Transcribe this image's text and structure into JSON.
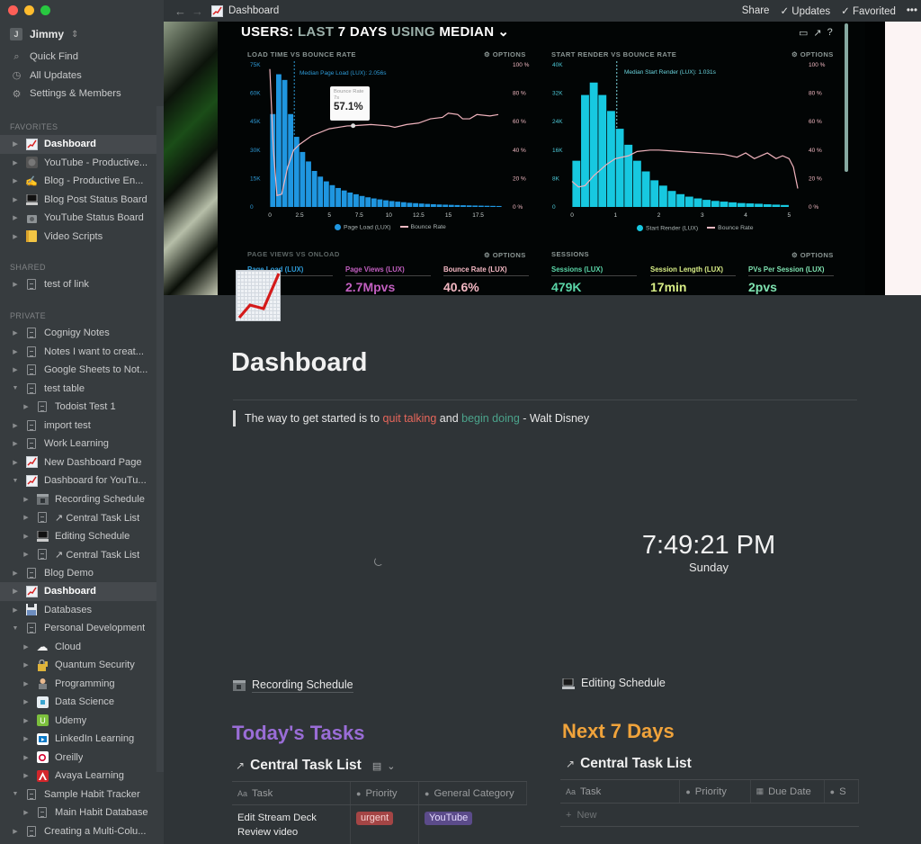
{
  "window": {
    "traffic_lights": {
      "close": "#fe5f57",
      "minimize": "#febc2e",
      "zoom": "#28c840"
    }
  },
  "sidebar": {
    "workspace": {
      "avatar_letter": "J",
      "name": "Jimmy",
      "switch_icon": "⇕"
    },
    "nav": [
      {
        "icon": "search-icon",
        "glyph": "⌕",
        "label": "Quick Find"
      },
      {
        "icon": "clock-icon",
        "glyph": "◷",
        "label": "All Updates"
      },
      {
        "icon": "gear-icon",
        "glyph": "⚙",
        "label": "Settings & Members"
      }
    ],
    "sections": {
      "favorites": "FAVORITES",
      "shared": "SHARED",
      "private": "PRIVATE"
    },
    "favorites": [
      {
        "label": "Dashboard",
        "icon": "chart-increasing-icon",
        "active": true
      },
      {
        "label": "YouTube - Productive...",
        "icon": "youtube-page-icon"
      },
      {
        "label": "Blog - Productive En...",
        "icon": "writing-hand-icon"
      },
      {
        "label": "Blog Post Status Board",
        "icon": "laptop-icon"
      },
      {
        "label": "YouTube Status Board",
        "icon": "camera-icon"
      },
      {
        "label": "Video Scripts",
        "icon": "notebook-icon"
      }
    ],
    "shared": [
      {
        "label": "test of link",
        "icon": "page-icon"
      }
    ],
    "private": [
      {
        "label": "Cognigy Notes",
        "icon": "page-icon",
        "depth": 0,
        "expanded": false
      },
      {
        "label": "Notes I want to creat...",
        "icon": "page-icon",
        "depth": 0,
        "expanded": false
      },
      {
        "label": "Google Sheets to Not...",
        "icon": "page-icon",
        "depth": 0,
        "expanded": false
      },
      {
        "label": "test table",
        "icon": "page-icon",
        "depth": 0,
        "expanded": true
      },
      {
        "label": "Todoist Test 1",
        "icon": "page-icon",
        "depth": 1,
        "expanded": false
      },
      {
        "label": "import test",
        "icon": "page-icon",
        "depth": 0,
        "expanded": false
      },
      {
        "label": "Work Learning",
        "icon": "page-icon",
        "depth": 0,
        "expanded": false
      },
      {
        "label": "New Dashboard Page",
        "icon": "chart-increasing-icon",
        "depth": 0,
        "expanded": false
      },
      {
        "label": "Dashboard for YouTu...",
        "icon": "chart-increasing-icon",
        "depth": 0,
        "expanded": true
      },
      {
        "label": "Recording Schedule",
        "icon": "cinema-icon",
        "depth": 1,
        "expanded": false
      },
      {
        "label": "↗ Central Task List",
        "icon": "page-icon",
        "depth": 1,
        "expanded": false
      },
      {
        "label": "Editing Schedule",
        "icon": "laptop-icon",
        "depth": 1,
        "expanded": false
      },
      {
        "label": "↗ Central Task List",
        "icon": "page-icon",
        "depth": 1,
        "expanded": false
      },
      {
        "label": "Blog Demo",
        "icon": "page-icon",
        "depth": 0,
        "expanded": false
      },
      {
        "label": "Dashboard",
        "icon": "chart-increasing-icon",
        "depth": 0,
        "expanded": false,
        "active": true
      },
      {
        "label": "Databases",
        "icon": "floppy-disk-icon",
        "depth": 0,
        "expanded": false
      },
      {
        "label": "Personal Development",
        "icon": "page-icon",
        "depth": 0,
        "expanded": true
      },
      {
        "label": "Cloud",
        "icon": "cloud-icon",
        "depth": 1,
        "expanded": false
      },
      {
        "label": "Quantum Security",
        "icon": "lock-key-icon",
        "depth": 1,
        "expanded": false
      },
      {
        "label": "Programming",
        "icon": "technologist-icon",
        "depth": 1,
        "expanded": false
      },
      {
        "label": "Data Science",
        "icon": "data-science-icon",
        "depth": 1,
        "expanded": false
      },
      {
        "label": "Udemy",
        "icon": "udemy-icon",
        "depth": 1,
        "expanded": false
      },
      {
        "label": "LinkedIn Learning",
        "icon": "linkedin-learning-icon",
        "depth": 1,
        "expanded": false
      },
      {
        "label": "Oreilly",
        "icon": "oreilly-icon",
        "depth": 1,
        "expanded": false
      },
      {
        "label": "Avaya Learning",
        "icon": "avaya-icon",
        "depth": 1,
        "expanded": false
      },
      {
        "label": "Sample Habit Tracker",
        "icon": "page-icon",
        "depth": 0,
        "expanded": true
      },
      {
        "label": "Main Habit Database",
        "icon": "page-icon",
        "depth": 1,
        "expanded": false
      },
      {
        "label": "Creating a Multi-Colu...",
        "icon": "page-icon",
        "depth": 0,
        "expanded": false
      }
    ]
  },
  "topbar": {
    "back": "←",
    "forward": "→",
    "page_title": "Dashboard",
    "share": "Share",
    "updates": "✓ Updates",
    "favorited": "✓ Favorited",
    "more": "•••"
  },
  "cover": {
    "header_parts": [
      {
        "text": "USERS: ",
        "dim": false
      },
      {
        "text": "LAST ",
        "dim": true
      },
      {
        "text": "7 DAYS ",
        "dim": false
      },
      {
        "text": "USING ",
        "dim": true
      },
      {
        "text": "MEDIAN",
        "dim": false
      }
    ],
    "header_chevron": "⌄",
    "top_icons": [
      "▭",
      "↗",
      "?"
    ],
    "options_label": "⚙ OPTIONS",
    "left_chart": {
      "title": "LOAD TIME VS BOUNCE RATE",
      "median_label": "Median Page Load (LUX): 2.056s",
      "tooltip": {
        "label": "Bounce Rate",
        "sub": "7s",
        "value": "57.1%"
      },
      "legend": {
        "bars": "Page Load (LUX)",
        "line": "Bounce Rate"
      }
    },
    "right_chart": {
      "title": "START RENDER VS BOUNCE RATE",
      "median_label": "Median Start Render (LUX): 1.031s",
      "legend": {
        "bars": "Start Render (LUX)",
        "line": "Bounce Rate"
      }
    },
    "kpi_left": {
      "title": "PAGE VIEWS VS ONLOAD",
      "items": [
        {
          "label": "Page Load (LUX)",
          "value": "",
          "color": "#2e9ad6"
        },
        {
          "label": "Page Views (LUX)",
          "value": "2.7Mpvs",
          "color": "#c25fc0"
        },
        {
          "label": "Bounce Rate (LUX)",
          "value": "40.6%",
          "color": "#f4b8c3"
        }
      ]
    },
    "kpi_right": {
      "title": "SESSIONS",
      "items": [
        {
          "label": "Sessions (LUX)",
          "value": "479K",
          "color": "#5bd6a8"
        },
        {
          "label": "Session Length (LUX)",
          "value": "17min",
          "color": "#d9ef87"
        },
        {
          "label": "PVs Per Session (LUX)",
          "value": "2pvs",
          "color": "#7fe3b1"
        }
      ]
    }
  },
  "chart_data": [
    {
      "type": "bar",
      "title": "LOAD TIME VS BOUNCE RATE",
      "xlabel": "",
      "ylabel": "Page Load (LUX)",
      "y2label": "Bounce Rate",
      "x_ticks": [
        "0",
        "2.5",
        "5",
        "7.5",
        "10",
        "12.5",
        "15",
        "17.5"
      ],
      "xlim": [
        0,
        19.5
      ],
      "ylim": [
        0,
        75000
      ],
      "y_ticks": [
        "0",
        "15K",
        "30K",
        "45K",
        "60K",
        "75K"
      ],
      "y2lim": [
        0,
        100
      ],
      "y2_ticks": [
        "0 %",
        "20 %",
        "40 %",
        "60 %",
        "80 %",
        "100 %"
      ],
      "bar_width": 0.5,
      "series": [
        {
          "name": "Page Load (LUX)",
          "color": "#1f96e0",
          "values": [
            49000,
            70000,
            67000,
            49000,
            37000,
            29000,
            24000,
            19000,
            16000,
            13500,
            11500,
            10000,
            8700,
            7600,
            6700,
            5800,
            5100,
            4500,
            4000,
            3500,
            3100,
            2800,
            2500,
            2200,
            2000,
            1800,
            1600,
            1450,
            1300,
            1200,
            1100,
            1000,
            900,
            820,
            750,
            680,
            620,
            560,
            500
          ]
        },
        {
          "name": "Bounce Rate",
          "color": "#f0b3bd",
          "kind": "line",
          "x": [
            0,
            0.3,
            0.6,
            1.0,
            1.5,
            2.0,
            2.5,
            3.5,
            5,
            6.5,
            7.0,
            8.5,
            10,
            10.5,
            11.5,
            12.5,
            13.5,
            14.5,
            15,
            15.8,
            16.2,
            16.8,
            17.4,
            18.5,
            19.2
          ],
          "values": [
            97,
            40,
            8,
            9,
            28,
            40,
            44,
            50,
            55,
            57,
            57.1,
            58,
            57,
            56,
            58,
            59,
            62,
            63,
            66,
            65,
            62,
            62,
            65,
            64,
            65
          ]
        }
      ],
      "median_x": 2.056,
      "legend": "bottom"
    },
    {
      "type": "bar",
      "title": "START RENDER VS BOUNCE RATE",
      "xlabel": "",
      "ylabel": "Start Render (LUX)",
      "y2label": "Bounce Rate",
      "x_ticks": [
        "0",
        "1",
        "2",
        "3",
        "4",
        "5"
      ],
      "xlim": [
        0,
        5.2
      ],
      "ylim": [
        0,
        40000
      ],
      "y_ticks": [
        "0",
        "8K",
        "16K",
        "24K",
        "32K",
        "40K"
      ],
      "y2lim": [
        0,
        100
      ],
      "y2_ticks": [
        "0 %",
        "20 %",
        "40 %",
        "60 %",
        "80 %",
        "100 %"
      ],
      "bar_width": 0.2,
      "series": [
        {
          "name": "Start Render (LUX)",
          "color": "#17c8e0",
          "values": [
            13000,
            31500,
            35000,
            31500,
            27000,
            22000,
            17500,
            13000,
            10000,
            7500,
            6000,
            4500,
            3600,
            2900,
            2400,
            2000,
            1700,
            1500,
            1300,
            1100,
            1000,
            900,
            750,
            650,
            550
          ]
        },
        {
          "name": "Bounce Rate",
          "color": "#f0b3bd",
          "kind": "line",
          "x": [
            0,
            0.15,
            0.3,
            0.5,
            0.8,
            1.0,
            1.3,
            1.5,
            1.8,
            2.0,
            2.5,
            3.0,
            3.5,
            3.8,
            4.0,
            4.2,
            4.5,
            4.7,
            4.85,
            5.0,
            5.1,
            5.2
          ],
          "values": [
            18,
            14,
            15,
            22,
            30,
            34,
            36,
            39,
            40,
            40,
            39,
            38,
            37,
            35,
            38,
            34,
            38,
            34,
            36,
            34,
            28,
            13
          ]
        }
      ],
      "median_x": 1.031,
      "legend": "bottom"
    }
  ],
  "page": {
    "title": "Dashboard",
    "quote": {
      "before": "The way to get started is to ",
      "red": "quit talking",
      "middle": " and ",
      "teal": "begin doing",
      "after": " - Walt Disney"
    },
    "clock": {
      "time": "7:49:21 PM",
      "day": "Sunday"
    },
    "left_column": {
      "linked_page": "Recording Schedule",
      "heading": "Today's Tasks",
      "heading_color": "#9a6dd7",
      "db_title": "Central Task List",
      "view_icon": "▤",
      "columns": [
        {
          "icon": "Aa",
          "label": "Task"
        },
        {
          "icon": "●",
          "label": "Priority"
        },
        {
          "icon": "●",
          "label": "General Category"
        }
      ],
      "rows": [
        {
          "task": "Edit Stream Deck Review video",
          "priority": {
            "label": "urgent",
            "bg": "#a44545",
            "fg": "#f6d2d2"
          },
          "category": {
            "label": "YouTube",
            "bg": "#5b4b8a",
            "fg": "#e6dcff"
          }
        }
      ]
    },
    "right_column": {
      "linked_page": "Editing Schedule",
      "heading": "Next 7 Days",
      "heading_color": "#f0a33b",
      "db_title": "Central Task List",
      "columns": [
        {
          "icon": "Aa",
          "label": "Task"
        },
        {
          "icon": "●",
          "label": "Priority"
        },
        {
          "icon": "▦",
          "label": "Due Date"
        },
        {
          "icon": "●",
          "label": "S"
        }
      ],
      "new_row": "New"
    }
  }
}
